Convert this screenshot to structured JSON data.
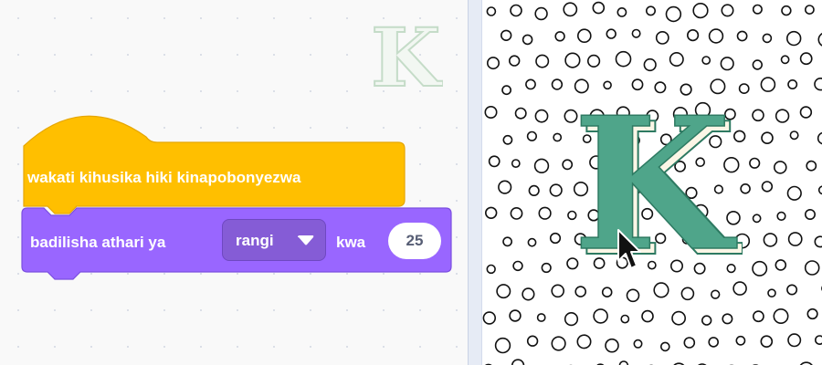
{
  "workspace": {
    "hat_block": {
      "label": "wakati kihusika hiki kinapobonyezwa",
      "color": "#ffbf00"
    },
    "effect_block": {
      "prefix": "badilisha athari ya",
      "effect_option": "rangi",
      "middle": "kwa",
      "value": "25",
      "color": "#9966ff"
    },
    "sprite_thumbnail": {
      "letter": "K",
      "color": "#d3e6d6"
    }
  },
  "stage": {
    "sprite": {
      "letter": "K",
      "name": "K",
      "color": "#4fa58a"
    },
    "backdrop": "polka-dot-circles"
  }
}
